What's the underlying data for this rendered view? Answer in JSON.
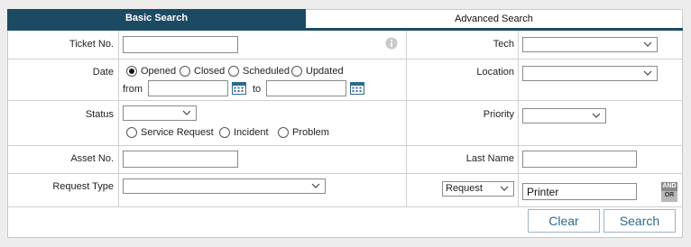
{
  "tabs": {
    "basic": "Basic Search",
    "advanced": "Advanced Search"
  },
  "fields": {
    "ticket_no": {
      "label": "Ticket No.",
      "value": ""
    },
    "tech": {
      "label": "Tech",
      "selected": ""
    },
    "date": {
      "label": "Date",
      "options": [
        "Opened",
        "Closed",
        "Scheduled",
        "Updated"
      ],
      "selected": "Opened",
      "from_label": "from",
      "to_label": "to",
      "from_value": "",
      "to_value": ""
    },
    "location": {
      "label": "Location",
      "selected": ""
    },
    "status": {
      "label": "Status",
      "selected": "",
      "types": [
        "Service Request",
        "Incident",
        "Problem"
      ]
    },
    "priority": {
      "label": "Priority",
      "selected": ""
    },
    "asset_no": {
      "label": "Asset No.",
      "value": ""
    },
    "last_name": {
      "label": "Last Name",
      "value": ""
    },
    "request_type": {
      "label": "Request Type",
      "selected": ""
    },
    "request_filter": {
      "selected": "Request",
      "value": "Printer"
    }
  },
  "andor": {
    "and": "AND",
    "or": "OR"
  },
  "buttons": {
    "clear": "Clear",
    "search": "Search"
  },
  "colors": {
    "tab_active": "#1d4a63",
    "button_text": "#2d6a8f"
  }
}
